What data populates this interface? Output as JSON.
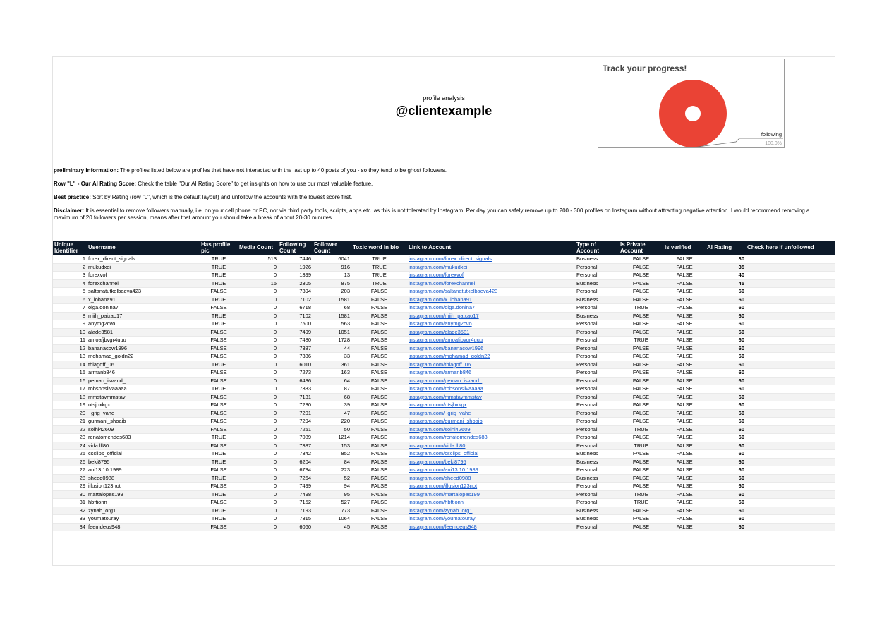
{
  "header": {
    "subtitle": "profile analysis",
    "title": "@clientexample"
  },
  "chart_data": {
    "type": "pie",
    "title": "Track your progress!",
    "slices": [
      {
        "label": "following",
        "value": 100.0,
        "percent_label": "100,0%",
        "color": "#ea4335"
      }
    ]
  },
  "info": [
    {
      "label": "preliminary information:",
      "text": " The profiles listed below are profiles that have not interacted with the last up to 40 posts of you - so they tend to be ghost followers."
    },
    {
      "label": "Row \"L\" - Our AI Rating Score:",
      "text": " Check the table \"Our AI Rating Score\" to get insights on how to use our most valuable feature."
    },
    {
      "label": "Best practice:",
      "text": " Sort by Rating (row \"L\", which is the default layout) and unfollow the accounts with the lowest score first."
    },
    {
      "label": "Disclaimer:",
      "text": " It is essential to remove followers manually, i.e. on your cell phone or PC, not via third party tools, scripts, apps etc. as this is not tolerated by Instagram. Per day you can safely remove up to 200 - 300 profiles on Instagram without attracting negative attention. I would recommend removing a maximum of 20 followers per session, means after that amount you should take a break of about 20-30 minutes."
    }
  ],
  "table": {
    "columns": [
      "Unique Identifier",
      "Username",
      "Has profile pic",
      "Media Count",
      "Following Count",
      "Follower Count",
      "Toxic word in bio",
      "Link to Account",
      "Type of Account",
      "Is Private Account",
      "is verified",
      "AI Rating",
      "Check here if unfollowed"
    ],
    "rows": [
      [
        "1",
        "forex_direct_signals",
        "TRUE",
        "513",
        "7446",
        "6041",
        "TRUE",
        "instagram.com/forex_direct_signals",
        "Business",
        "FALSE",
        "FALSE",
        "30",
        ""
      ],
      [
        "2",
        "mukudxei",
        "TRUE",
        "0",
        "1926",
        "916",
        "TRUE",
        "instagram.com/mukudxei",
        "Personal",
        "FALSE",
        "FALSE",
        "35",
        ""
      ],
      [
        "3",
        "forexvof",
        "TRUE",
        "0",
        "1399",
        "13",
        "TRUE",
        "instagram.com/forexvof",
        "Personal",
        "FALSE",
        "FALSE",
        "40",
        ""
      ],
      [
        "4",
        "forexchannel",
        "TRUE",
        "15",
        "2305",
        "875",
        "TRUE",
        "instagram.com/forexchannel",
        "Business",
        "FALSE",
        "FALSE",
        "45",
        ""
      ],
      [
        "5",
        "saltanatutkelbaeva423",
        "FALSE",
        "0",
        "7394",
        "203",
        "FALSE",
        "instagram.com/saltanatutkelbaeva423",
        "Personal",
        "FALSE",
        "FALSE",
        "60",
        ""
      ],
      [
        "6",
        "x_iohana91",
        "TRUE",
        "0",
        "7102",
        "1581",
        "FALSE",
        "instagram.com/x_iohana91",
        "Business",
        "FALSE",
        "FALSE",
        "60",
        ""
      ],
      [
        "7",
        "olga.donina7",
        "FALSE",
        "0",
        "6718",
        "68",
        "FALSE",
        "instagram.com/olga.donina7",
        "Personal",
        "TRUE",
        "FALSE",
        "60",
        ""
      ],
      [
        "8",
        "miih_paixao17",
        "TRUE",
        "0",
        "7102",
        "1581",
        "FALSE",
        "instagram.com/miih_paixao17",
        "Business",
        "FALSE",
        "FALSE",
        "60",
        ""
      ],
      [
        "9",
        "anymg2cvo",
        "TRUE",
        "0",
        "7500",
        "563",
        "FALSE",
        "instagram.com/anymg2cvo",
        "Personal",
        "FALSE",
        "FALSE",
        "60",
        ""
      ],
      [
        "10",
        "alade3581",
        "FALSE",
        "0",
        "7499",
        "1051",
        "FALSE",
        "instagram.com/alade3581",
        "Personal",
        "FALSE",
        "FALSE",
        "60",
        ""
      ],
      [
        "11",
        "amoafjbvgr4uuu",
        "FALSE",
        "0",
        "7480",
        "1728",
        "FALSE",
        "instagram.com/amoafjbvgr4uuu",
        "Personal",
        "TRUE",
        "FALSE",
        "60",
        ""
      ],
      [
        "12",
        "bananacow1996",
        "FALSE",
        "0",
        "7387",
        "44",
        "FALSE",
        "instagram.com/bananacow1996",
        "Personal",
        "FALSE",
        "FALSE",
        "60",
        ""
      ],
      [
        "13",
        "mohamad_goldn22",
        "FALSE",
        "0",
        "7336",
        "33",
        "FALSE",
        "instagram.com/mohamad_goldn22",
        "Personal",
        "FALSE",
        "FALSE",
        "60",
        ""
      ],
      [
        "14",
        "thiagoff_06",
        "TRUE",
        "0",
        "6010",
        "361",
        "FALSE",
        "instagram.com/thiagoff_06",
        "Personal",
        "FALSE",
        "FALSE",
        "60",
        ""
      ],
      [
        "15",
        "armanb846",
        "FALSE",
        "0",
        "7273",
        "163",
        "FALSE",
        "instagram.com/armanb846",
        "Personal",
        "FALSE",
        "FALSE",
        "60",
        ""
      ],
      [
        "16",
        "peman_isvand_",
        "FALSE",
        "0",
        "6436",
        "64",
        "FALSE",
        "instagram.com/peman_isvand_",
        "Personal",
        "FALSE",
        "FALSE",
        "60",
        ""
      ],
      [
        "17",
        "robsonsilvaaaaa",
        "TRUE",
        "0",
        "7333",
        "87",
        "FALSE",
        "instagram.com/robsonsilvaaaaa",
        "Personal",
        "FALSE",
        "FALSE",
        "60",
        ""
      ],
      [
        "18",
        "mmstavmmstav",
        "FALSE",
        "0",
        "7131",
        "68",
        "FALSE",
        "instagram.com/mmstavmmstav",
        "Personal",
        "FALSE",
        "FALSE",
        "60",
        ""
      ],
      [
        "19",
        "utsjbxkgx",
        "FALSE",
        "0",
        "7230",
        "39",
        "FALSE",
        "instagram.com/utsjbxkgx",
        "Personal",
        "FALSE",
        "FALSE",
        "60",
        ""
      ],
      [
        "20",
        "_grig_vahe",
        "FALSE",
        "0",
        "7201",
        "47",
        "FALSE",
        "instagram.com/_grig_vahe",
        "Personal",
        "FALSE",
        "FALSE",
        "60",
        ""
      ],
      [
        "21",
        "gurmani_shoaib",
        "FALSE",
        "0",
        "7294",
        "220",
        "FALSE",
        "instagram.com/gurmani_shoaib",
        "Personal",
        "FALSE",
        "FALSE",
        "60",
        ""
      ],
      [
        "22",
        "solhi42609",
        "FALSE",
        "0",
        "7251",
        "50",
        "FALSE",
        "instagram.com/solhi42609",
        "Personal",
        "TRUE",
        "FALSE",
        "60",
        ""
      ],
      [
        "23",
        "renatomendes683",
        "TRUE",
        "0",
        "7089",
        "1214",
        "FALSE",
        "instagram.com/renatomendes683",
        "Personal",
        "FALSE",
        "FALSE",
        "60",
        ""
      ],
      [
        "24",
        "vida.lll80",
        "FALSE",
        "0",
        "7387",
        "153",
        "FALSE",
        "instagram.com/vida.lll80",
        "Personal",
        "TRUE",
        "FALSE",
        "60",
        ""
      ],
      [
        "25",
        "csclips_official",
        "TRUE",
        "0",
        "7342",
        "852",
        "FALSE",
        "instagram.com/csclips_official",
        "Business",
        "FALSE",
        "FALSE",
        "60",
        ""
      ],
      [
        "26",
        "beki8795",
        "TRUE",
        "0",
        "6204",
        "84",
        "FALSE",
        "instagram.com/beki8795",
        "Business",
        "FALSE",
        "FALSE",
        "60",
        ""
      ],
      [
        "27",
        "ani13.10.1989",
        "FALSE",
        "0",
        "6734",
        "223",
        "FALSE",
        "instagram.com/ani13.10.1989",
        "Personal",
        "FALSE",
        "FALSE",
        "60",
        ""
      ],
      [
        "28",
        "sheed0988",
        "TRUE",
        "0",
        "7264",
        "52",
        "FALSE",
        "instagram.com/sheed0988",
        "Business",
        "FALSE",
        "FALSE",
        "60",
        ""
      ],
      [
        "29",
        "illusion123not",
        "FALSE",
        "0",
        "7499",
        "94",
        "FALSE",
        "instagram.com/illusion123not",
        "Personal",
        "FALSE",
        "FALSE",
        "60",
        ""
      ],
      [
        "30",
        "martalopes199",
        "TRUE",
        "0",
        "7498",
        "95",
        "FALSE",
        "instagram.com/martalopes199",
        "Personal",
        "TRUE",
        "FALSE",
        "60",
        ""
      ],
      [
        "31",
        "hbftionn",
        "FALSE",
        "0",
        "7152",
        "527",
        "FALSE",
        "instagram.com/hbftionn",
        "Personal",
        "TRUE",
        "FALSE",
        "60",
        ""
      ],
      [
        "32",
        "zynab_org1",
        "TRUE",
        "0",
        "7193",
        "773",
        "FALSE",
        "instagram.com/zynab_org1",
        "Business",
        "FALSE",
        "FALSE",
        "60",
        ""
      ],
      [
        "33",
        "youmatouray",
        "TRUE",
        "0",
        "7315",
        "1064",
        "FALSE",
        "instagram.com/youmatouray",
        "Business",
        "FALSE",
        "FALSE",
        "60",
        ""
      ],
      [
        "34",
        "feemdeus948",
        "FALSE",
        "0",
        "6060",
        "45",
        "FALSE",
        "instagram.com/feemdeus948",
        "Personal",
        "FALSE",
        "FALSE",
        "60",
        ""
      ]
    ]
  }
}
